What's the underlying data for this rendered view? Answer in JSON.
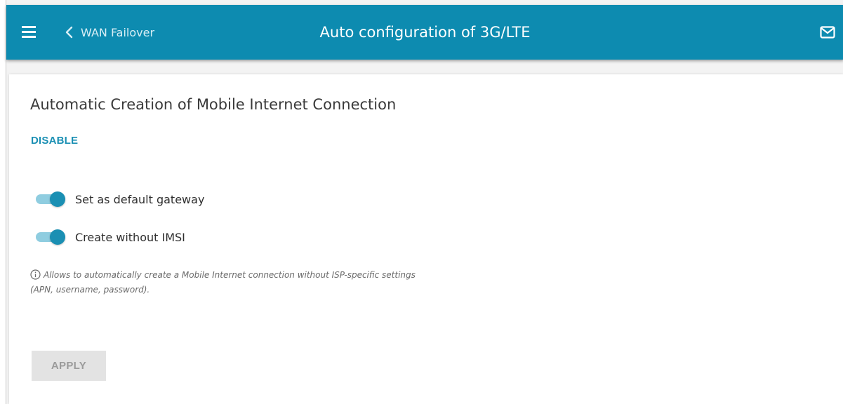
{
  "header": {
    "back_label": "WAN Failover",
    "title": "Auto configuration of 3G/LTE",
    "menu_icon": "hamburger-menu-icon",
    "back_icon": "chevron-left-icon",
    "mail_icon": "envelope-icon"
  },
  "section": {
    "heading": "Automatic Creation of Mobile Internet Connection",
    "disable_label": "DISABLE"
  },
  "toggles": [
    {
      "label": "Set as default gateway",
      "state": "on"
    },
    {
      "label": "Create without IMSI",
      "state": "on"
    }
  ],
  "hint": {
    "icon": "info-icon",
    "text": "Allows to automatically create a Mobile Internet connection without ISP-specific settings (APN, username, password)."
  },
  "actions": {
    "apply_label": "APPLY",
    "apply_enabled": "false"
  },
  "colors": {
    "header_bg": "#0d8bb0",
    "accent": "#1a8fb3",
    "toggle_track": "#8fcde0",
    "disabled_button_bg": "#e3e3e3",
    "disabled_button_text": "#9b9b9b"
  }
}
